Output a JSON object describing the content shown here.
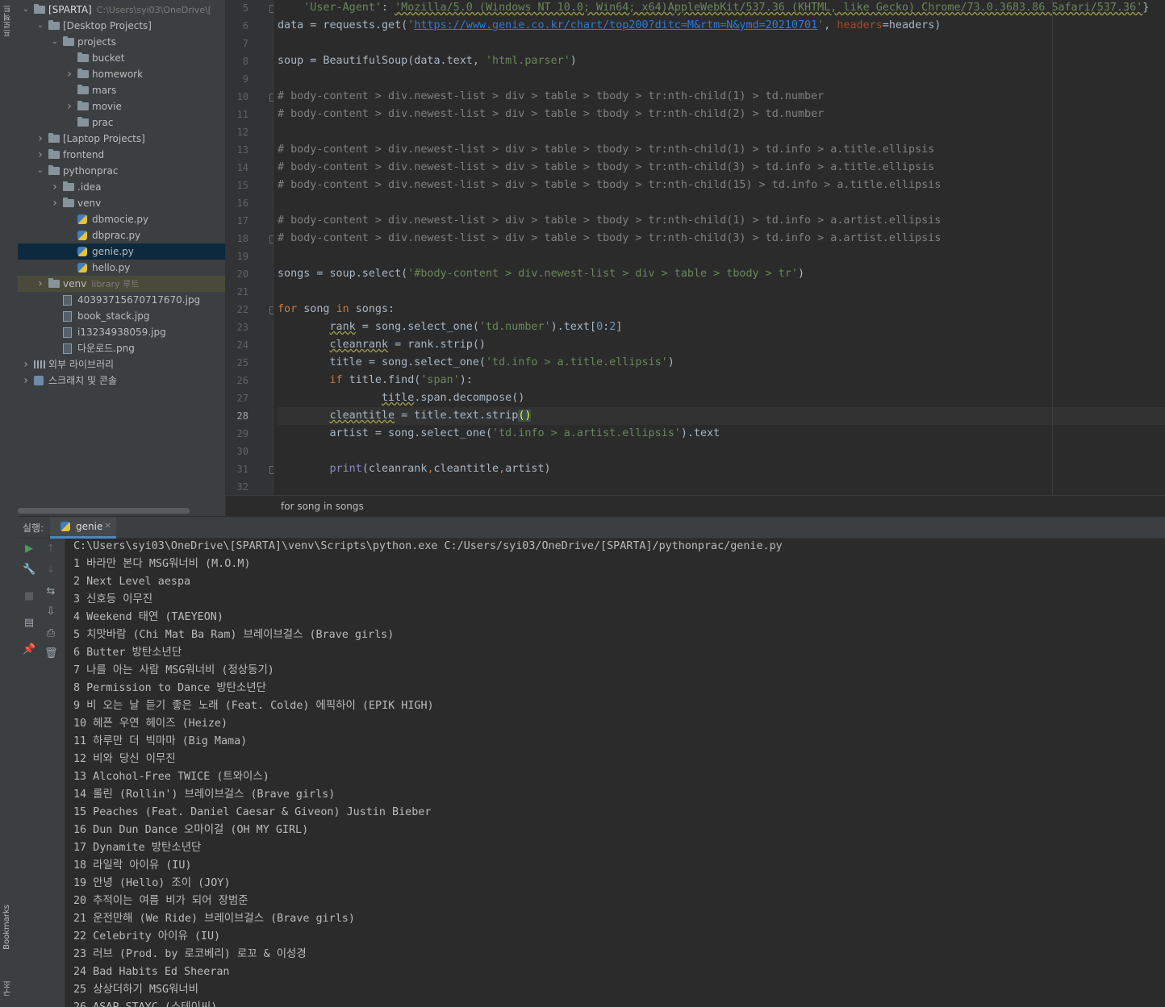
{
  "sidebar_labels": {
    "project": "프로젝트",
    "bookmarks": "Bookmarks",
    "structure": "구조"
  },
  "project_tree": [
    {
      "label": "[SPARTA]",
      "sub": "C:\\Users\\syi03\\OneDrive\\[",
      "indent": 0,
      "type": "folder",
      "arrow": "down"
    },
    {
      "label": "[Desktop Projects]",
      "sub": "",
      "indent": 1,
      "type": "folder",
      "arrow": "down"
    },
    {
      "label": "projects",
      "sub": "",
      "indent": 2,
      "type": "folder",
      "arrow": "down"
    },
    {
      "label": "bucket",
      "sub": "",
      "indent": 3,
      "type": "folder",
      "arrow": ""
    },
    {
      "label": "homework",
      "sub": "",
      "indent": 3,
      "type": "folder",
      "arrow": "right"
    },
    {
      "label": "mars",
      "sub": "",
      "indent": 3,
      "type": "folder",
      "arrow": ""
    },
    {
      "label": "movie",
      "sub": "",
      "indent": 3,
      "type": "folder",
      "arrow": "right"
    },
    {
      "label": "prac",
      "sub": "",
      "indent": 3,
      "type": "folder",
      "arrow": ""
    },
    {
      "label": "[Laptop Projects]",
      "sub": "",
      "indent": 1,
      "type": "folder",
      "arrow": "right"
    },
    {
      "label": "frontend",
      "sub": "",
      "indent": 1,
      "type": "folder",
      "arrow": "right"
    },
    {
      "label": "pythonprac",
      "sub": "",
      "indent": 1,
      "type": "folder",
      "arrow": "down"
    },
    {
      "label": ".idea",
      "sub": "",
      "indent": 2,
      "type": "folder",
      "arrow": "right"
    },
    {
      "label": "venv",
      "sub": "",
      "indent": 2,
      "type": "folder",
      "arrow": "right"
    },
    {
      "label": "dbmocie.py",
      "sub": "",
      "indent": 3,
      "type": "py",
      "arrow": ""
    },
    {
      "label": "dbprac.py",
      "sub": "",
      "indent": 3,
      "type": "py",
      "arrow": ""
    },
    {
      "label": "genie.py",
      "sub": "",
      "indent": 3,
      "type": "py",
      "arrow": "",
      "selected": true
    },
    {
      "label": "hello.py",
      "sub": "",
      "indent": 3,
      "type": "py",
      "arrow": ""
    },
    {
      "label": "venv",
      "sub": "library 루트",
      "indent": 1,
      "type": "folder",
      "arrow": "right",
      "muted": true
    },
    {
      "label": "40393715670717670.jpg",
      "sub": "",
      "indent": 2,
      "type": "img",
      "arrow": ""
    },
    {
      "label": "book_stack.jpg",
      "sub": "",
      "indent": 2,
      "type": "img",
      "arrow": ""
    },
    {
      "label": "i13234938059.jpg",
      "sub": "",
      "indent": 2,
      "type": "img",
      "arrow": ""
    },
    {
      "label": "다운로드.png",
      "sub": "",
      "indent": 2,
      "type": "img",
      "arrow": ""
    },
    {
      "label": "외부 라이브러리",
      "sub": "",
      "indent": 0,
      "type": "lib",
      "arrow": "right"
    },
    {
      "label": "스크래치 및 콘솔",
      "sub": "",
      "indent": 0,
      "type": "scratch",
      "arrow": "right"
    }
  ],
  "editor": {
    "current_line": 28,
    "lines": [
      {
        "n": 5,
        "fold": true,
        "html": "    <span class=\"str\">'User-Agent'</span>: <span class=\"str\" style=\"text-decoration:underline wavy #9a9a4a\">'Mozilla/5.0 (Windows NT 10.0; Win64; x64)AppleWebKit/537.36 (KHTML, like Gecko) Chrome/73.0.3683.86 Safari/537.36'</span>}"
      },
      {
        "n": 6,
        "html": "data = requests.get(<span class=\"str\">'</span><span class=\"url\">https://www.genie.co.kr/chart/top200?ditc=M&amp;rtm=N&amp;ymd=20210701</span><span class=\"str\">'</span>, <span class=\"param\">headers</span>=headers)"
      },
      {
        "n": 7,
        "html": ""
      },
      {
        "n": 8,
        "html": "soup = BeautifulSoup(data.text, <span class=\"str\">'html.parser'</span>)"
      },
      {
        "n": 9,
        "html": ""
      },
      {
        "n": 10,
        "fold": true,
        "html": "<span class=\"cm\"># body-content &gt; div.newest-list &gt; div &gt; table &gt; tbody &gt; tr:nth-child(1) &gt; td.number</span>"
      },
      {
        "n": 11,
        "html": "<span class=\"cm\"># body-content &gt; div.newest-list &gt; div &gt; table &gt; tbody &gt; tr:nth-child(2) &gt; td.number</span>"
      },
      {
        "n": 12,
        "html": ""
      },
      {
        "n": 13,
        "html": "<span class=\"cm\"># body-content &gt; div.newest-list &gt; div &gt; table &gt; tbody &gt; tr:nth-child(1) &gt; td.info &gt; a.title.ellipsis</span>"
      },
      {
        "n": 14,
        "html": "<span class=\"cm\"># body-content &gt; div.newest-list &gt; div &gt; table &gt; tbody &gt; tr:nth-child(3) &gt; td.info &gt; a.title.ellipsis</span>"
      },
      {
        "n": 15,
        "html": "<span class=\"cm\"># body-content &gt; div.newest-list &gt; div &gt; table &gt; tbody &gt; tr:nth-child(15) &gt; td.info &gt; a.title.ellipsis</span>"
      },
      {
        "n": 16,
        "html": ""
      },
      {
        "n": 17,
        "html": "<span class=\"cm\"># body-content &gt; div.newest-list &gt; div &gt; table &gt; tbody &gt; tr:nth-child(1) &gt; td.info &gt; a.artist.ellipsis</span>"
      },
      {
        "n": 18,
        "fold": true,
        "html": "<span class=\"cm\"># body-content &gt; div.newest-list &gt; div &gt; table &gt; tbody &gt; tr:nth-child(3) &gt; td.info &gt; a.artist.ellipsis</span>"
      },
      {
        "n": 19,
        "html": ""
      },
      {
        "n": 20,
        "html": "songs = soup.select(<span class=\"str\">'#body-content &gt; div.newest-list &gt; div &gt; table &gt; tbody &gt; tr'</span>)"
      },
      {
        "n": 21,
        "html": ""
      },
      {
        "n": 22,
        "fold": true,
        "html": "<span class=\"kw\">for</span> song <span class=\"kw\">in</span> songs:"
      },
      {
        "n": 23,
        "html": "        <span class=\"wavy\">rank</span> = song.select_one(<span class=\"str\">'td.number'</span>).text[<span class=\"num\">0</span>:<span class=\"num\">2</span>]"
      },
      {
        "n": 24,
        "html": "        <span class=\"wavy\">cleanrank</span> = rank.strip()"
      },
      {
        "n": 25,
        "html": "        title = song.select_one(<span class=\"str\">'td.info &gt; a.title.ellipsis'</span>)"
      },
      {
        "n": 26,
        "html": "        <span class=\"kw\">if</span> title.find(<span class=\"str\">'span'</span>):"
      },
      {
        "n": 27,
        "html": "                <span class=\"wavy\">title</span>.span.decompose()"
      },
      {
        "n": 28,
        "html": "        <span class=\"wavy\">cleantitle</span> = title.text.strip<span class=\"brk\">()</span>"
      },
      {
        "n": 29,
        "html": "        artist = song.select_one(<span class=\"str\">'td.info &gt; a.artist.ellipsis'</span>).text"
      },
      {
        "n": 30,
        "html": ""
      },
      {
        "n": 31,
        "fold": true,
        "html": "        <span class=\"fn\">print</span>(cleanrank<span class=\"kw\">,</span>cleantitle<span class=\"kw\">,</span>artist)"
      },
      {
        "n": 32,
        "html": ""
      }
    ]
  },
  "breadcrumb": "for song in songs",
  "run_panel": {
    "label": "실행:",
    "tab": "genie",
    "close": "×"
  },
  "console_lines": [
    "C:\\Users\\syi03\\OneDrive\\[SPARTA]\\venv\\Scripts\\python.exe C:/Users/syi03/OneDrive/[SPARTA]/pythonprac/genie.py",
    "1 바라만 본다 MSG워너비 (M.O.M)",
    "2 Next Level aespa",
    "3 신호등 이무진",
    "4 Weekend 태연 (TAEYEON)",
    "5 치맛바람 (Chi Mat Ba Ram) 브레이브걸스 (Brave girls)",
    "6 Butter 방탄소년단",
    "7 나를 아는 사람 MSG워너비 (정상동기)",
    "8 Permission to Dance 방탄소년단",
    "9 비 오는 날 듣기 좋은 노래 (Feat. Colde) 에픽하이 (EPIK HIGH)",
    "10 헤픈 우연 헤이즈 (Heize)",
    "11 하루만 더 빅마마 (Big Mama)",
    "12 비와 당신 이무진",
    "13 Alcohol-Free TWICE (트와이스)",
    "14 롤린 (Rollin') 브레이브걸스 (Brave girls)",
    "15 Peaches (Feat. Daniel Caesar & Giveon) Justin Bieber",
    "16 Dun Dun Dance 오마이걸 (OH MY GIRL)",
    "17 Dynamite 방탄소년단",
    "18 라일락 아이유 (IU)",
    "19 안녕 (Hello) 조이 (JOY)",
    "20 추적이는 여름 비가 되어 장범준",
    "21 운전만해 (We Ride) 브레이브걸스 (Brave girls)",
    "22 Celebrity 아이유 (IU)",
    "23 러브 (Prod. by 로코베리) 로꼬 & 이성경",
    "24 Bad Habits Ed Sheeran",
    "25 상상더하기 MSG워너비",
    "26 ASAP STAYC (스테이씨)"
  ],
  "run_tools": [
    {
      "name": "rerun-icon",
      "glyph": "▶",
      "color": "#499c54"
    },
    {
      "name": "wrench-icon",
      "glyph": "🔧",
      "color": "#9aa7b0"
    },
    {
      "name": "stop-icon",
      "glyph": "■",
      "color": "#5a5d5f"
    },
    {
      "name": "layout-icon",
      "glyph": "▤",
      "color": "#9aa7b0"
    },
    {
      "name": "pin-icon",
      "glyph": "📌",
      "color": "#9aa7b0"
    }
  ],
  "run_tools2": [
    {
      "name": "up-arrow-icon",
      "glyph": "↑",
      "color": "#5a5d5f"
    },
    {
      "name": "down-arrow-icon",
      "glyph": "↓",
      "color": "#5a5d5f"
    },
    {
      "name": "soft-wrap-icon",
      "glyph": "⇆",
      "color": "#9aa7b0"
    },
    {
      "name": "scroll-to-end-icon",
      "glyph": "⇩",
      "color": "#9aa7b0"
    },
    {
      "name": "print-icon",
      "glyph": "⎙",
      "color": "#9aa7b0"
    },
    {
      "name": "trash-icon",
      "glyph": "🗑",
      "color": "#9aa7b0"
    }
  ]
}
